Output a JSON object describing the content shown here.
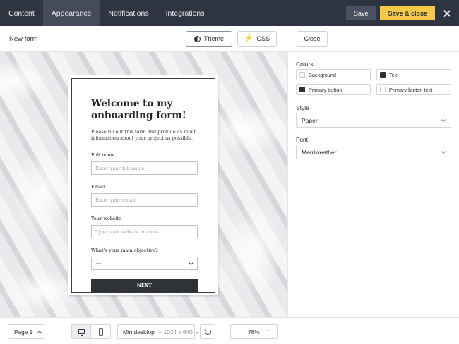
{
  "nav": {
    "tabs": [
      {
        "label": "Content"
      },
      {
        "label": "Appearance"
      },
      {
        "label": "Notifications"
      },
      {
        "label": "Integrations"
      }
    ],
    "save_label": "Save",
    "save_close_label": "Save & close"
  },
  "toolbar": {
    "form_name": "New form",
    "theme_label": "Theme",
    "css_label": "CSS",
    "close_label": "Close"
  },
  "form": {
    "title": "Welcome to my onboarding form!",
    "description": "Please fill out this form and provide as much information about your project as possible.",
    "fields": [
      {
        "label": "Full name",
        "placeholder": "Enter your full name"
      },
      {
        "label": "Email",
        "placeholder": "Enter your email"
      },
      {
        "label": "Your website",
        "placeholder": "Type your website address"
      }
    ],
    "objective_label": "What's your main objective?",
    "objective_value": "---",
    "next_label": "NEXT"
  },
  "panel": {
    "colors_heading": "Colors",
    "colors": [
      {
        "label": "Background",
        "color": "#ffffff"
      },
      {
        "label": "Text",
        "color": "#2b2f36"
      },
      {
        "label": "Primary button",
        "color": "#2b2f36"
      },
      {
        "label": "Primary button text",
        "color": "#ffffff"
      }
    ],
    "style_heading": "Style",
    "style_value": "Paper",
    "font_heading": "Font",
    "font_value": "Merriweather"
  },
  "bottom": {
    "page_label": "Page 1",
    "resolution_name": "Min desktop",
    "resolution_dims": "– 1024 x 640",
    "zoom_value": "78%",
    "zoom_minus": "−",
    "zoom_plus": "+"
  },
  "colors": {
    "topbar": "#2f3441",
    "accent": "#f7c948"
  }
}
